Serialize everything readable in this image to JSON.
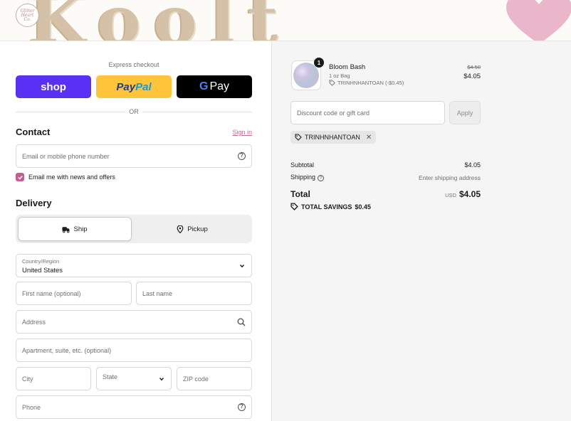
{
  "header": {
    "logo_line1": "Glitter",
    "logo_line2": "Heart",
    "logo_line3": "Co."
  },
  "express": {
    "label": "Express checkout",
    "shop_label": "shop",
    "paypal_part1": "Pay",
    "paypal_part2": "Pal",
    "gpay_g": "G",
    "gpay_label": "Pay",
    "or_label": "OR"
  },
  "contact": {
    "title": "Contact",
    "signin_label": "Sign in",
    "email_placeholder": "Email or mobile phone number",
    "newsletter_label": "Email me with news and offers",
    "newsletter_checked": true
  },
  "delivery": {
    "title": "Delivery",
    "ship_label": "Ship",
    "pickup_label": "Pickup",
    "country_label": "Country/Region",
    "country_value": "United States",
    "first_name_placeholder": "First name (optional)",
    "last_name_placeholder": "Last name",
    "address_placeholder": "Address",
    "apartment_placeholder": "Apartment, suite, etc. (optional)",
    "city_placeholder": "City",
    "state_placeholder": "State",
    "zip_placeholder": "ZIP code",
    "phone_placeholder": "Phone"
  },
  "order": {
    "item": {
      "quantity": "1",
      "name": "Bloom Bash",
      "variant": "1 oz Bag",
      "discount": "TRINHNHANTOAN (-$0.45)",
      "price_original": "$4.50",
      "price_final": "$4.05"
    },
    "discount_placeholder": "Discount code or gift card",
    "apply_label": "Apply",
    "applied_code": "TRINHNHANTOAN",
    "subtotal_label": "Subtotal",
    "subtotal_value": "$4.05",
    "shipping_label": "Shipping",
    "shipping_value": "Enter shipping address",
    "total_label": "Total",
    "total_currency": "USD",
    "total_value": "$4.05",
    "savings_label": "TOTAL SAVINGS",
    "savings_value": "$0.45"
  },
  "colors": {
    "shop_purple": "#5a31f4",
    "paypal_yellow": "#ffc439",
    "accent_pink": "#c75c92"
  }
}
